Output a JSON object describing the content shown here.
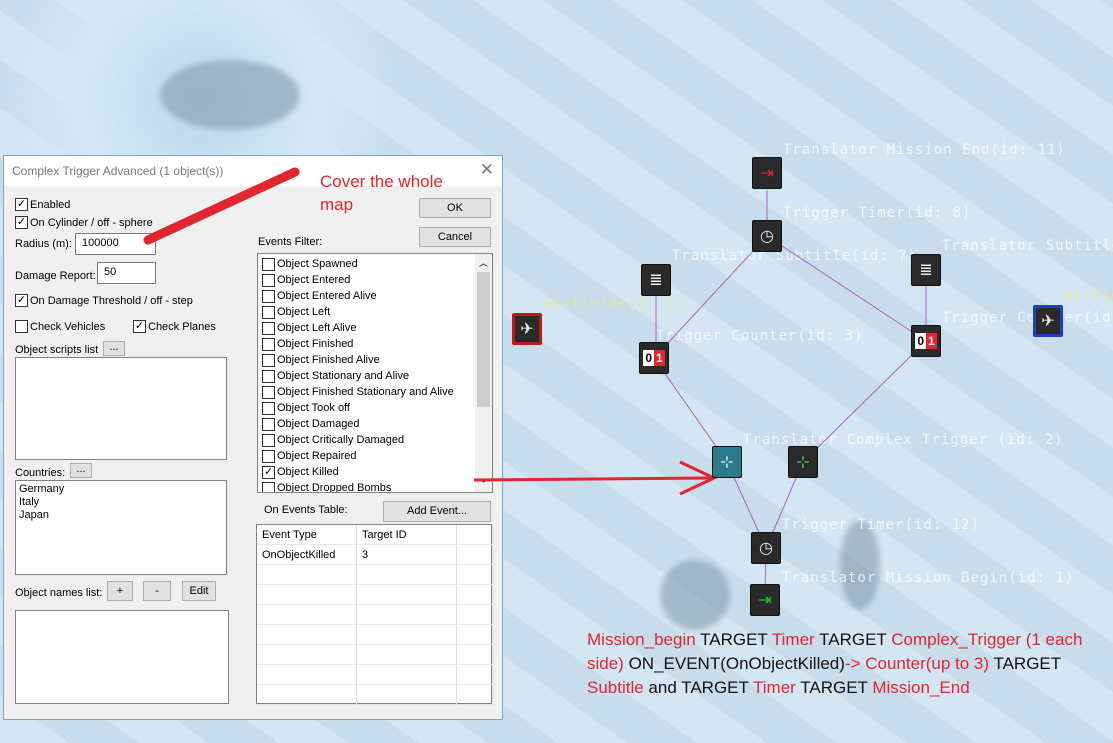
{
  "dialog": {
    "title": "Complex Trigger Advanced (1 object(s))",
    "enabled": "Enabled",
    "cylinder": "On Cylinder / off - sphere",
    "radius_label": "Radius (m):",
    "radius_value": "100000",
    "damage_label": "Damage Report:",
    "damage_value": "50",
    "threshold": "On Damage Threshold / off - step",
    "check_vehicles": "Check Vehicles",
    "check_planes": "Check Planes",
    "scripts_label": "Object scripts list",
    "ellipsis": "...",
    "countries_label": "Countries:",
    "countries": [
      "Germany",
      "Italy",
      "Japan"
    ],
    "names_label": "Object names list:",
    "plus": "+",
    "minus": "-",
    "edit": "Edit",
    "ok": "OK",
    "cancel": "Cancel",
    "filter_label": "Events Filter:",
    "events": [
      {
        "label": "Object Spawned",
        "checked": false
      },
      {
        "label": "Object Entered",
        "checked": false
      },
      {
        "label": "Object Entered Alive",
        "checked": false
      },
      {
        "label": "Object Left",
        "checked": false
      },
      {
        "label": "Object Left Alive",
        "checked": false
      },
      {
        "label": "Object Finished",
        "checked": false
      },
      {
        "label": "Object Finished Alive",
        "checked": false
      },
      {
        "label": "Object Stationary and Alive",
        "checked": false
      },
      {
        "label": "Object Finished Stationary and Alive",
        "checked": false
      },
      {
        "label": "Object Took off",
        "checked": false
      },
      {
        "label": "Object Damaged",
        "checked": false
      },
      {
        "label": "Object Critically Damaged",
        "checked": false
      },
      {
        "label": "Object Repaired",
        "checked": false
      },
      {
        "label": "Object Killed",
        "checked": true
      },
      {
        "label": "Object Dropped Bombs",
        "checked": false
      }
    ],
    "table_label": "On Events Table:",
    "add_event": "Add Event...",
    "columns": [
      "Event Type",
      "Target ID"
    ],
    "rows": [
      [
        "OnObjectKilled",
        "3"
      ]
    ]
  },
  "map": {
    "labels": {
      "end": "Translator Mission End(id: 11)",
      "timer_top": "Trigger Timer(id: 8)",
      "sub_left": "Translator Subtitle(id: 7)",
      "sub_right": "Translator Subtitle",
      "airfield_left": "Airfield(id: 5)",
      "airfield_right": "Airfield",
      "counter_left": "Trigger Counter(id: 3)",
      "counter_right": "Trigger Counter(id",
      "ct": "Translator Complex Trigger (id: 2)",
      "timer_bottom": "Trigger Timer(id: 12)",
      "begin": "Translator Mission Begin(id: 1)"
    },
    "counter_text": {
      "zero": "0",
      "one": "1"
    }
  },
  "annotations": {
    "cover": "Cover the whole map",
    "flow": [
      {
        "t": "Mission_begin",
        "r": true
      },
      {
        "t": " TARGET ",
        "r": false
      },
      {
        "t": "Timer",
        "r": true
      },
      {
        "t": " TARGET ",
        "r": false
      },
      {
        "t": "Complex_Trigger (1 each side)",
        "r": true
      },
      {
        "t": " ON_EVENT(OnObjectKilled)",
        "r": false
      },
      {
        "t": "-> Counter(up to 3)",
        "r": true
      },
      {
        "t": " TARGET ",
        "r": false
      },
      {
        "t": "Subtitle",
        "r": true
      },
      {
        "t": " and TARGET ",
        "r": false
      },
      {
        "t": "Timer",
        "r": true
      },
      {
        "t": " TARGET ",
        "r": false
      },
      {
        "t": "Mission_End",
        "r": true
      }
    ]
  },
  "colors": {
    "accent": "#e0262e"
  }
}
